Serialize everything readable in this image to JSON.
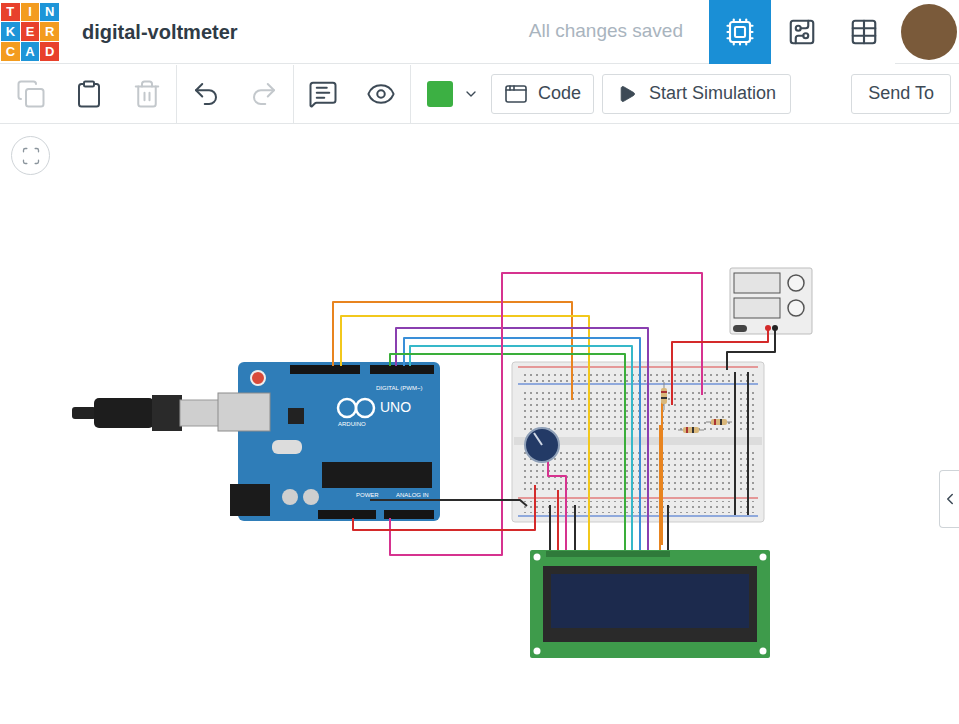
{
  "logo": [
    {
      "letter": "T",
      "color": "#e8412c"
    },
    {
      "letter": "I",
      "color": "#f39c1f"
    },
    {
      "letter": "N",
      "color": "#1e95d8"
    },
    {
      "letter": "K",
      "color": "#1e95d8"
    },
    {
      "letter": "E",
      "color": "#e8412c"
    },
    {
      "letter": "R",
      "color": "#f39c1f"
    },
    {
      "letter": "C",
      "color": "#f39c1f"
    },
    {
      "letter": "A",
      "color": "#1e95d8"
    },
    {
      "letter": "D",
      "color": "#e8412c"
    }
  ],
  "document": {
    "title": "digital-voltmeter",
    "status": "All changes saved"
  },
  "views": [
    {
      "selected": true
    },
    {
      "selected": false
    },
    {
      "selected": false
    }
  ],
  "tools": [
    {
      "disabled": true
    },
    {
      "disabled": false
    },
    {
      "disabled": true
    },
    {
      "disabled": false
    },
    {
      "disabled": true
    },
    {
      "disabled": false
    },
    {
      "disabled": false
    }
  ],
  "color_picker": {
    "color": "#3cb043"
  },
  "buttons": {
    "code": "Code",
    "simulate": "Start Simulation",
    "send": "Send To"
  },
  "arduino": {
    "model": "UNO",
    "brand": "ARDUINO",
    "digital": "DIGITAL (PWM~)",
    "power": "POWER",
    "analog": "ANALOG IN"
  },
  "wires": [
    {
      "color": "#e8841f"
    },
    {
      "color": "#f2c81c"
    },
    {
      "color": "#8a3fb0"
    },
    {
      "color": "#3a8fd8"
    },
    {
      "color": "#36b8c9"
    },
    {
      "color": "#3aae3a"
    },
    {
      "color": "#d6338f"
    },
    {
      "color": "#d42a2a"
    },
    {
      "color": "#d42a2a"
    },
    {
      "color": "#2b2b2b"
    },
    {
      "color": "#2b2b2b"
    },
    {
      "color": "#2b2b2b"
    },
    {
      "color": "#d42a2a"
    },
    {
      "color": "#d6338f"
    },
    {
      "color": "#2b2b2b"
    },
    {
      "color": "#e8841f"
    },
    {
      "color": "#2b2b2b"
    },
    {
      "color": "#2b2b2b"
    },
    {
      "color": "#2b2b2b"
    },
    {
      "color": "#e8841f"
    }
  ]
}
